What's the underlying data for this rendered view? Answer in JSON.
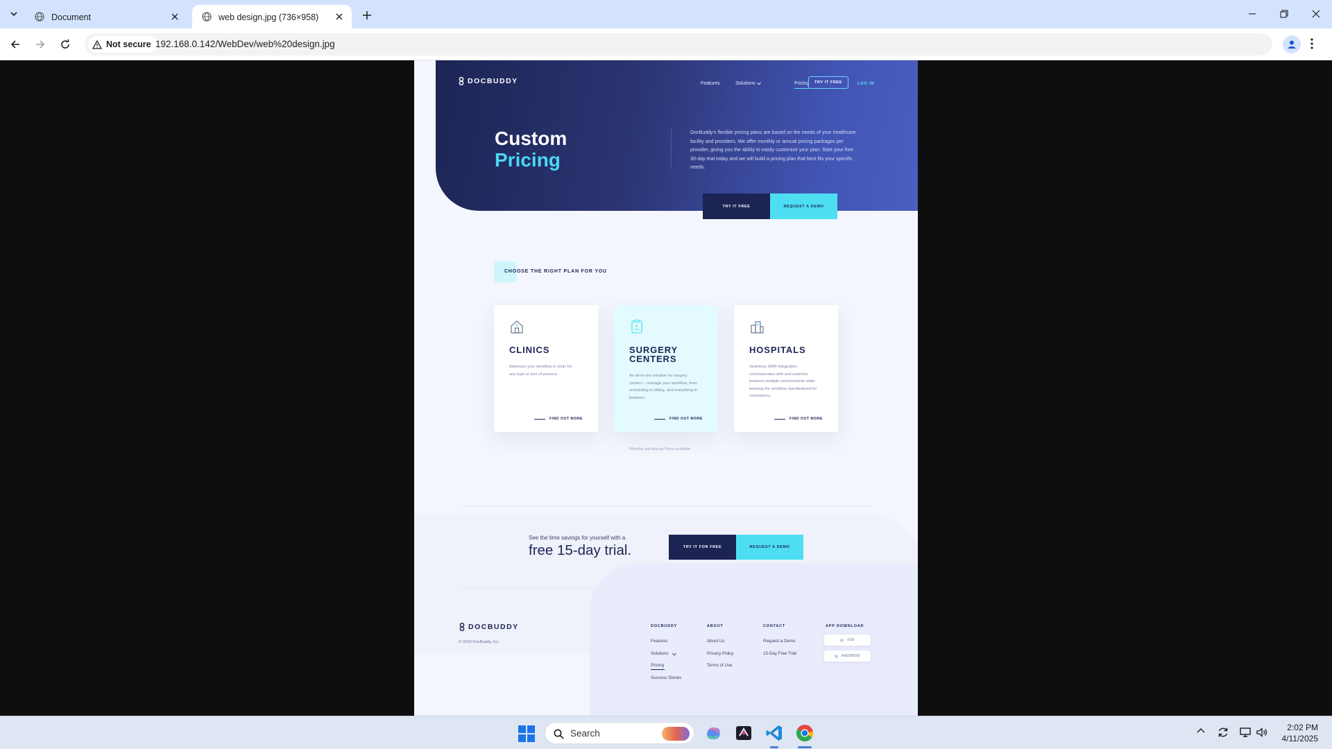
{
  "browser": {
    "tabs": [
      {
        "title": "Document",
        "active": false
      },
      {
        "title": "web design.jpg (736×958)",
        "active": true
      }
    ],
    "security_label": "Not secure",
    "url": "192.168.0.142/WebDev/web%20design.jpg"
  },
  "page": {
    "logo_text": "DOCBUDDY",
    "nav": {
      "features": "Features",
      "solutions": "Solutions",
      "pricing": "Pricing",
      "try_free": "TRY IT FREE",
      "login": "LOG IN"
    },
    "hero": {
      "title_line1": "Custom",
      "title_line2": "Pricing",
      "description": "DocBuddy's flexible pricing plans are based on the needs of your healthcare facility and providers. We offer monthly or annual pricing packages per provider, giving you the ability to easily customize your plan. Start your free 30-day trial today and we will build a pricing plan that best fits your specific needs.",
      "cta_primary": "TRY IT FREE",
      "cta_secondary": "REQUEST A DEMO"
    },
    "plans": {
      "section_label": "CHOOSE THE RIGHT PLAN FOR YOU",
      "cards": [
        {
          "title": "CLINICS",
          "description": "Maximize your workflow in clinic for any type or size of practice.",
          "link": "FIND OUT MORE",
          "icon": "house-icon",
          "highlighted": false
        },
        {
          "title_line1": "SURGERY",
          "title_line2": "CENTERS",
          "description": "An all-in-one solution for surgery centers – manage your workflow, from scheduling to billing, and everything in between.",
          "link": "FIND OUT MORE",
          "icon": "clipboard-icon",
          "highlighted": true
        },
        {
          "title": "HOSPITALS",
          "description": "Seamless EMR integration communicates with and switches between multiple environments while keeping the workflow standardized for consistency.",
          "link": "FIND OUT MORE",
          "icon": "buildings-icon",
          "highlighted": false
        }
      ],
      "footnote": "*Monthly and Annual Plans available"
    },
    "trial": {
      "pre": "See the time savings for yourself with a",
      "headline": "free 15-day trial.",
      "cta_primary": "TRY IT FOR FREE",
      "cta_secondary": "REQUEST A DEMO"
    },
    "footer": {
      "copyright": "© 2019 DocBuddy, Inc.",
      "columns": [
        {
          "heading": "DOCBUDDY",
          "links": [
            "Features",
            "Solutions",
            "Pricing",
            "Success Stories"
          ]
        },
        {
          "heading": "ABOUT",
          "links": [
            "About Us",
            "Privacy Policy",
            "Terms of Use"
          ]
        },
        {
          "heading": "CONTACT",
          "links": [
            "Request a Demo",
            "15-Day Free Trial"
          ]
        },
        {
          "heading": "APP DOWNLOAD",
          "links": [
            "iOS",
            "ANDROID"
          ]
        }
      ]
    },
    "colors": {
      "navy": "#1c2454",
      "cyan": "#4ddff1",
      "hero_end": "#4a5fc1",
      "page_bg": "#f4f6fd"
    }
  },
  "taskbar": {
    "search_placeholder": "Search",
    "time": "2:02 PM",
    "date": "4/11/2025",
    "apps": [
      "windows-start-icon",
      "copilot-icon",
      "git-kraken-icon",
      "vscode-icon",
      "chrome-icon"
    ]
  }
}
